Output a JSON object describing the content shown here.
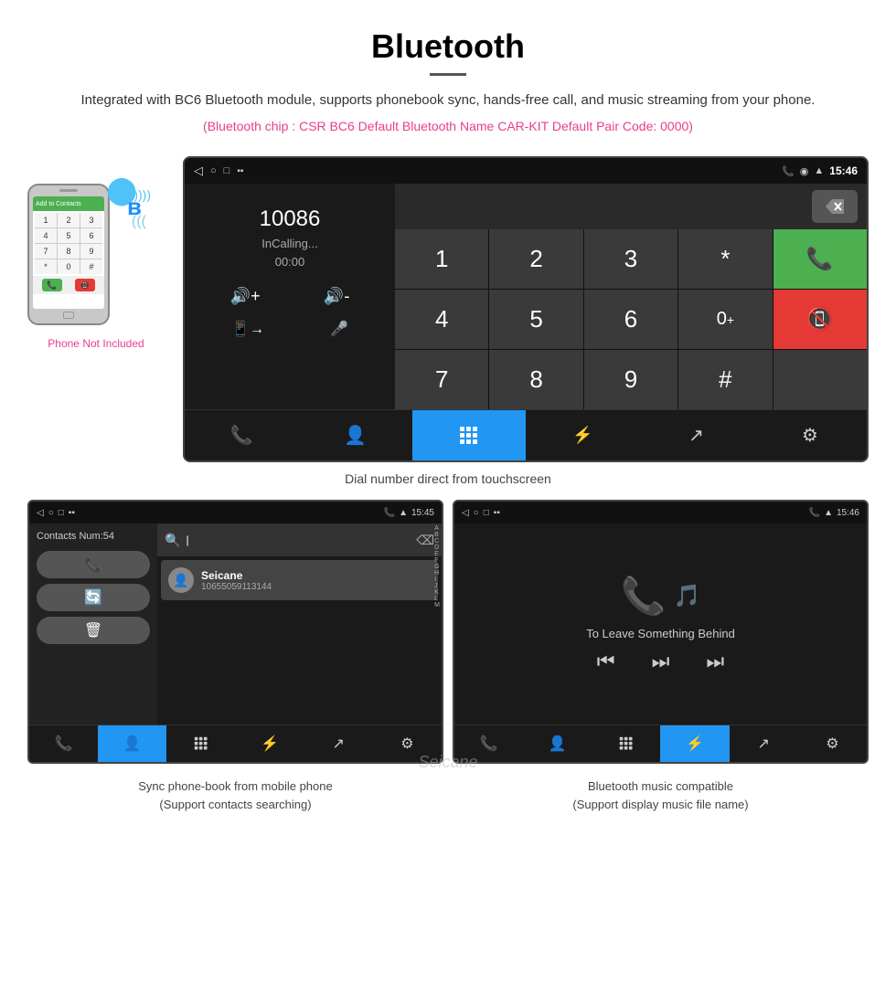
{
  "header": {
    "title": "Bluetooth",
    "description": "Integrated with BC6 Bluetooth module, supports phonebook sync, hands-free call, and music streaming from your phone.",
    "specs": "(Bluetooth chip : CSR BC6    Default Bluetooth Name CAR-KIT    Default Pair Code: 0000)"
  },
  "dial_screen": {
    "status_bar": {
      "time": "15:46",
      "icons": [
        "back",
        "rect",
        "square",
        "sim",
        "phone",
        "location",
        "wifi"
      ]
    },
    "number": "10086",
    "status": "InCalling...",
    "timer": "00:00",
    "keypad": [
      "1",
      "2",
      "3",
      "*",
      "4",
      "5",
      "6",
      "0+",
      "7",
      "8",
      "9",
      "#"
    ],
    "caption": "Dial number direct from touchscreen"
  },
  "contacts_screen": {
    "status_bar_time": "15:45",
    "contacts_num": "Contacts Num:54",
    "contact_name": "Seicane",
    "contact_phone": "10655059113144",
    "alpha_list": [
      "A",
      "B",
      "C",
      "D",
      "E",
      "F",
      "G",
      "H",
      "I",
      "J",
      "K",
      "L",
      "M"
    ],
    "caption_line1": "Sync phone-book from mobile phone",
    "caption_line2": "(Support contacts searching)"
  },
  "music_screen": {
    "status_bar_time": "15:46",
    "song_title": "To Leave Something Behind",
    "caption_line1": "Bluetooth music compatible",
    "caption_line2": "(Support display music file name)"
  },
  "phone_illustration": {
    "not_included": "Phone Not Included",
    "screen_label": "Add to Contacts"
  },
  "watermark": "Seicane",
  "nav_icons": {
    "phone": "📞",
    "contacts": "👤",
    "keypad": "⠿",
    "bluetooth": "⚡",
    "transfer": "↗",
    "settings": "⚙"
  }
}
